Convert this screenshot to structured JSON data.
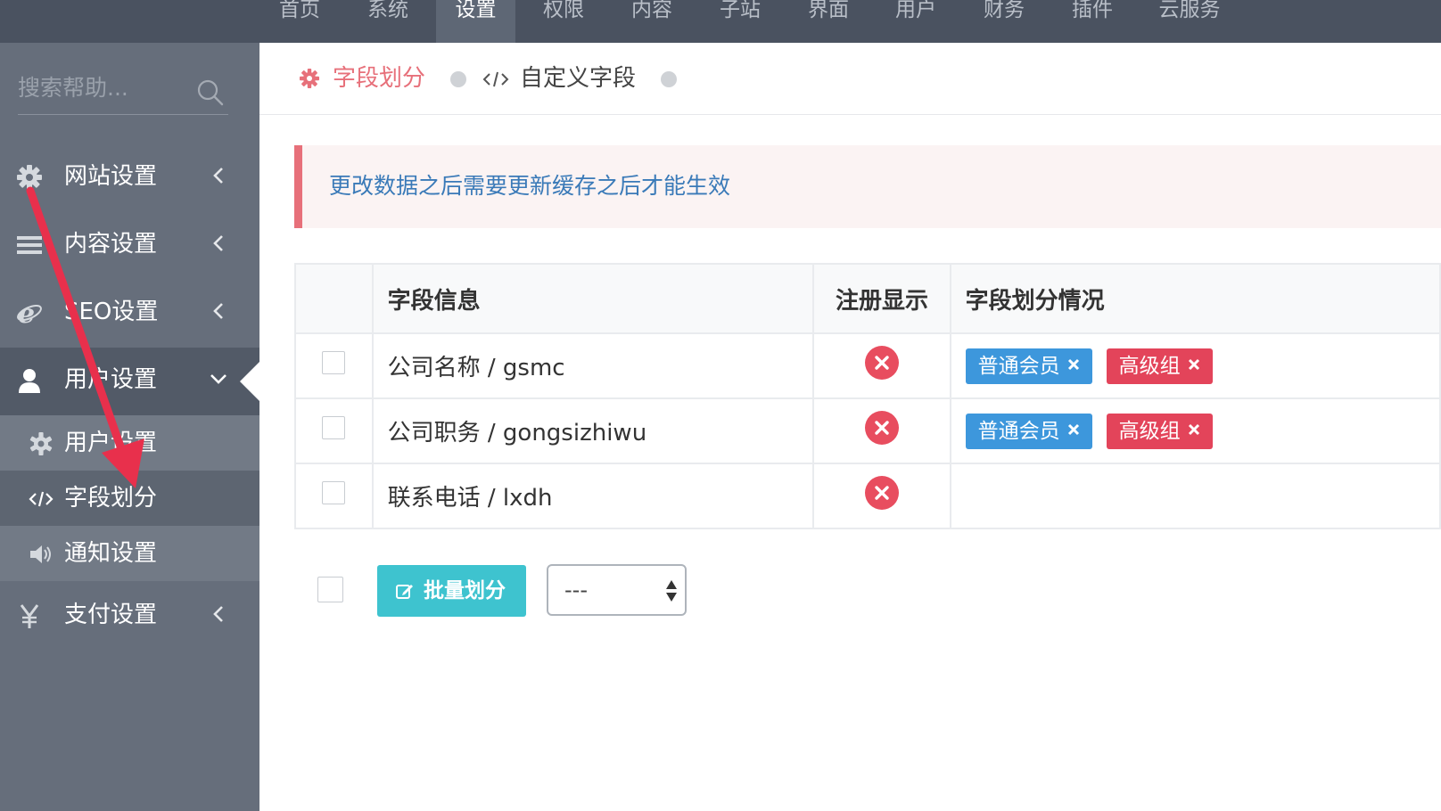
{
  "topnav": {
    "items": [
      {
        "label": "首页"
      },
      {
        "label": "系统"
      },
      {
        "label": "设置"
      },
      {
        "label": "权限"
      },
      {
        "label": "内容"
      },
      {
        "label": "子站"
      },
      {
        "label": "界面"
      },
      {
        "label": "用户"
      },
      {
        "label": "财务"
      },
      {
        "label": "插件"
      },
      {
        "label": "云服务"
      }
    ],
    "active": "设置"
  },
  "sidebar": {
    "search_placeholder": "搜索帮助...",
    "items": [
      {
        "label": "网站设置",
        "icon": "gear-icon"
      },
      {
        "label": "内容设置",
        "icon": "list-icon"
      },
      {
        "label": "SEO设置",
        "icon": "ie-icon"
      },
      {
        "label": "用户设置",
        "icon": "user-icon"
      },
      {
        "label": "支付设置",
        "icon": "yen-icon"
      }
    ],
    "sub_items": [
      {
        "label": "用户设置",
        "icon": "gear-icon"
      },
      {
        "label": "字段划分",
        "icon": "code-icon"
      },
      {
        "label": "通知设置",
        "icon": "volume-icon"
      }
    ]
  },
  "breadcrumb": {
    "current": "字段划分",
    "next": "自定义字段"
  },
  "alert": {
    "text": "更改数据之后需要更新缓存之后才能生效"
  },
  "table": {
    "headers": {
      "info": "字段信息",
      "register": "注册显示",
      "status": "字段划分情况"
    },
    "rows": [
      {
        "info": "公司名称 / gsmc",
        "tags": [
          "普通会员",
          "高级组"
        ]
      },
      {
        "info": "公司职务 / gongsizhiwu",
        "tags": [
          "普通会员",
          "高级组"
        ]
      },
      {
        "info": "联系电话 / lxdh",
        "tags": []
      }
    ]
  },
  "footer": {
    "batch_label": "批量划分",
    "select_value": "---"
  },
  "colors": {
    "accent_red": "#e7707a",
    "teal": "#3ec3cf",
    "blue_tag": "#3d97dc",
    "red_tag": "#e3445a"
  }
}
